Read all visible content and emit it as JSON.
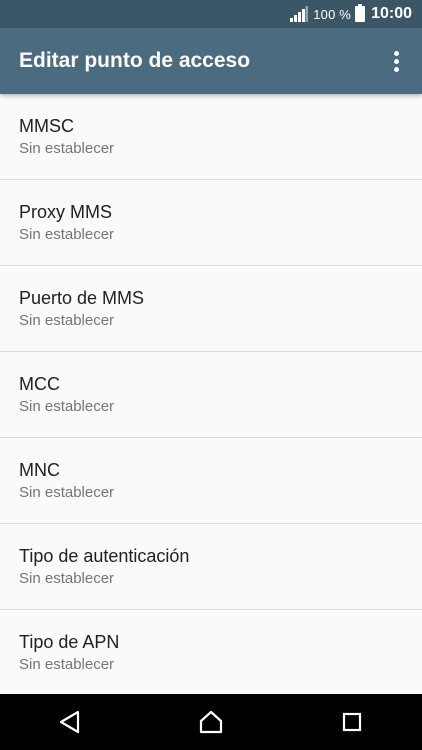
{
  "status_bar": {
    "battery_text": "100 %",
    "time": "10:00"
  },
  "app_bar": {
    "title": "Editar punto de acceso",
    "menu_icon": "more-vert-icon"
  },
  "settings": [
    {
      "title": "MMSC",
      "value": "Sin establecer"
    },
    {
      "title": "Proxy MMS",
      "value": "Sin establecer"
    },
    {
      "title": "Puerto de MMS",
      "value": "Sin establecer"
    },
    {
      "title": "MCC",
      "value": "Sin establecer"
    },
    {
      "title": "MNC",
      "value": "Sin establecer"
    },
    {
      "title": "Tipo de autenticación",
      "value": "Sin establecer"
    },
    {
      "title": "Tipo de APN",
      "value": "Sin establecer"
    }
  ],
  "nav_bar": {
    "back_icon": "back-icon",
    "home_icon": "home-icon",
    "recents_icon": "recents-icon"
  },
  "colors": {
    "status_bar": "#3b5666",
    "app_bar": "#4b6b80",
    "background": "#fafafa"
  }
}
